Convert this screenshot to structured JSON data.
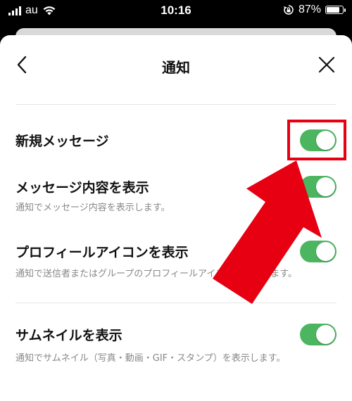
{
  "status_bar": {
    "carrier": "au",
    "time": "10:16",
    "battery_percent": "87%",
    "battery_level": 0.87
  },
  "nav": {
    "title": "通知"
  },
  "settings": [
    {
      "label": "新規メッセージ",
      "description": "",
      "enabled": true
    },
    {
      "label": "メッセージ内容を表示",
      "description": "通知でメッセージ内容を表示します。",
      "enabled": true
    },
    {
      "label": "プロフィールアイコンを表示",
      "description": "通知で送信者またはグループのプロフィールアイコンを表示します。",
      "enabled": true
    },
    {
      "label": "サムネイルを表示",
      "description": "通知でサムネイル（写真・動画・GIF・スタンプ）を表示します。",
      "enabled": true
    }
  ],
  "colors": {
    "toggle_on": "#4cb560",
    "annotation_red": "#e60012"
  }
}
